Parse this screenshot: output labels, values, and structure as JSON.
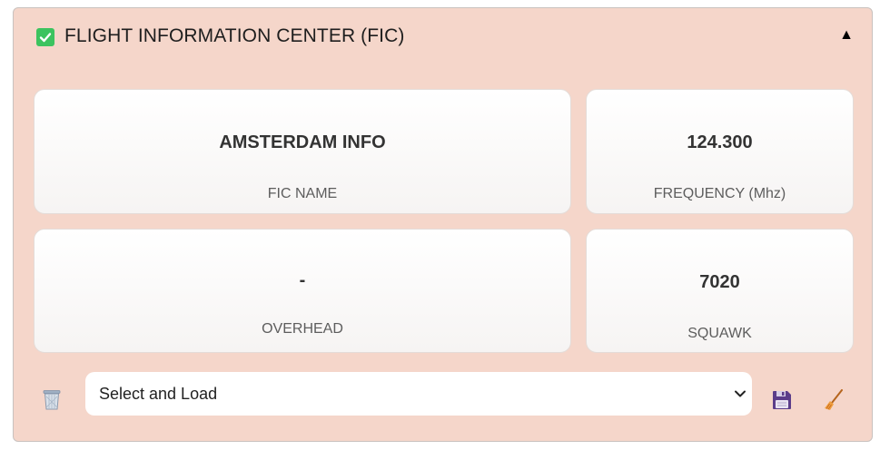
{
  "header": {
    "title": "FLIGHT INFORMATION CENTER (FIC)",
    "collapse_symbol": "▲",
    "checkbox_icon": "checkbox-checked-icon"
  },
  "cards": {
    "fic_name": {
      "value": "AMSTERDAM INFO",
      "label": "FIC NAME"
    },
    "frequency": {
      "value": "124.300",
      "label": "FREQUENCY (Mhz)"
    },
    "overhead": {
      "value": "-",
      "label": "OVERHEAD"
    },
    "squawk": {
      "value": "7020",
      "label": "SQUAWK"
    }
  },
  "toolbar": {
    "delete_icon": "trash-icon",
    "select": {
      "selected": "Select and Load",
      "chevron": "chevron-down-icon"
    },
    "save_icon": "floppy-disk-icon",
    "clear_icon": "broom-icon"
  },
  "colors": {
    "panel_background": "#f5d6ca",
    "checkbox_green": "#3cc35f",
    "save_icon_purple": "#5b3d8a",
    "broom_orange": "#e07a2f"
  }
}
